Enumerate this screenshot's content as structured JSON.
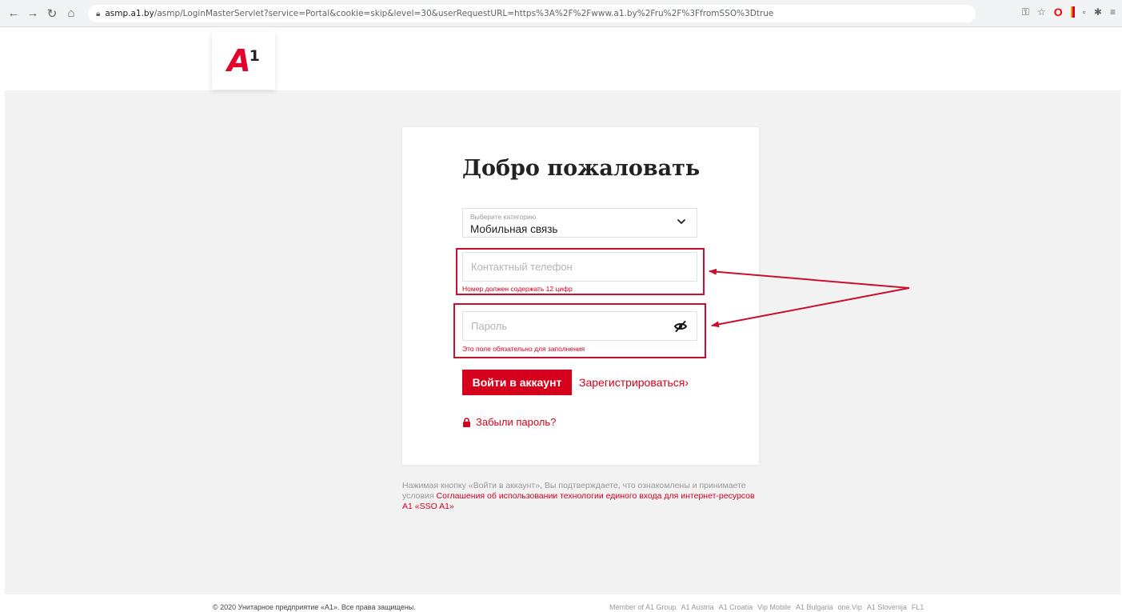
{
  "browser": {
    "url_host": "asmp.a1.by",
    "url_path": "/asmp/LoginMasterServlet?service=Portal&cookie=skip&level=30&userRequestURL=https%3A%2F%2Fwww.a1.by%2Fru%2F%3FfromSSO%3Dtrue"
  },
  "logo": {
    "letter": "A",
    "digit": "1"
  },
  "login": {
    "title": "Добро пожаловать",
    "category_label": "Выберите категорию",
    "category_value": "Мобильная связь",
    "phone_placeholder": "Контактный телефон",
    "phone_error": "Номер должен содержать 12 цифр",
    "password_placeholder": "Пароль",
    "password_error": "Это поле обязательно для заполнения",
    "login_button": "Войти в аккаунт",
    "register_link": "Зарегистрироваться",
    "register_chevron": "›",
    "forgot_password": "Забыли пароль?"
  },
  "terms": {
    "text": "Нажимая кнопку «Войти в аккаунт», Вы подтверждаете, что ознакомлены и принимаете условия ",
    "link": "Соглашения об использовании технологии единого входа для интернет-ресурсов А1 «SSO A1»"
  },
  "footer": {
    "copyright": "© 2020 Унитарное предприятие «А1». Все права защищены.",
    "partners": [
      "Member of A1 Group",
      "A1 Austria",
      "A1 Croatia",
      "Vip Mobile",
      "A1 Bulgaria",
      "one.Vip",
      "A1 Slovenija",
      "FL1"
    ]
  },
  "colors": {
    "brand_red": "#d5001c",
    "annotation_red": "#c8102e",
    "page_bg": "#f2f2f2"
  },
  "icons": {
    "back": "back-arrow-icon",
    "forward": "forward-arrow-icon",
    "reload": "reload-icon",
    "home": "home-icon",
    "secure": "lock-icon",
    "select": "chevron-down-icon",
    "password_toggle": "eye-slash-icon",
    "forgot": "padlock-icon"
  }
}
